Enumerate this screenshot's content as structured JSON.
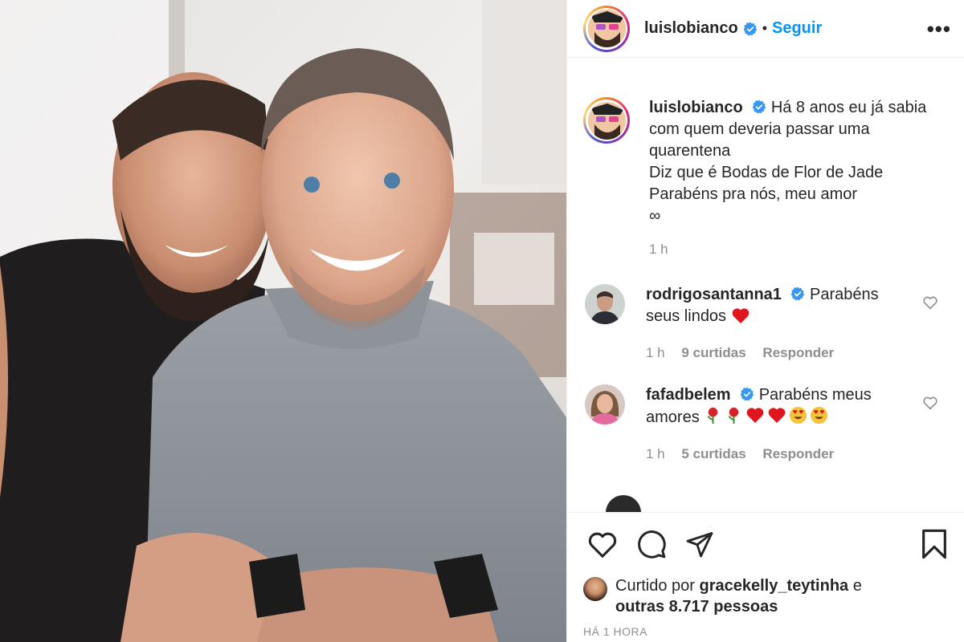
{
  "post": {
    "author": "luislobianco",
    "follow_label": "Seguir",
    "dot": "•",
    "more": "•••"
  },
  "caption": {
    "username": "luislobianco",
    "lines": [
      "Há 8 anos eu já sabia",
      "com quem deveria passar uma",
      "quarentena",
      "Diz que é Bodas de Flor de Jade",
      "Parabéns pra nós, meu amor",
      "∞"
    ],
    "time": "1 h"
  },
  "comments": [
    {
      "username": "rodrigosantanna1",
      "text_line1": "Parabéns",
      "text_line2": "seus lindos",
      "time": "1 h",
      "likes": "9 curtidas",
      "reply": "Responder"
    },
    {
      "username": "fafadbelem",
      "text_line1": "Parabéns meus",
      "text_line2": "amores",
      "time": "1 h",
      "likes": "5 curtidas",
      "reply": "Responder"
    }
  ],
  "likes": {
    "prefix": "Curtido por",
    "user": "gracekelly_teytinha",
    "conj": "e",
    "others": "outras 8.717 pessoas"
  },
  "timestamp": "HÁ 1 HORA",
  "colors": {
    "accent": "#0095f6",
    "muted": "#8e8e8e",
    "text": "#262626",
    "heart_red": "#ed4956"
  },
  "icons": [
    "like-icon",
    "comment-icon",
    "share-icon",
    "save-icon",
    "verified-icon",
    "more-icon",
    "heart-outline-icon"
  ]
}
